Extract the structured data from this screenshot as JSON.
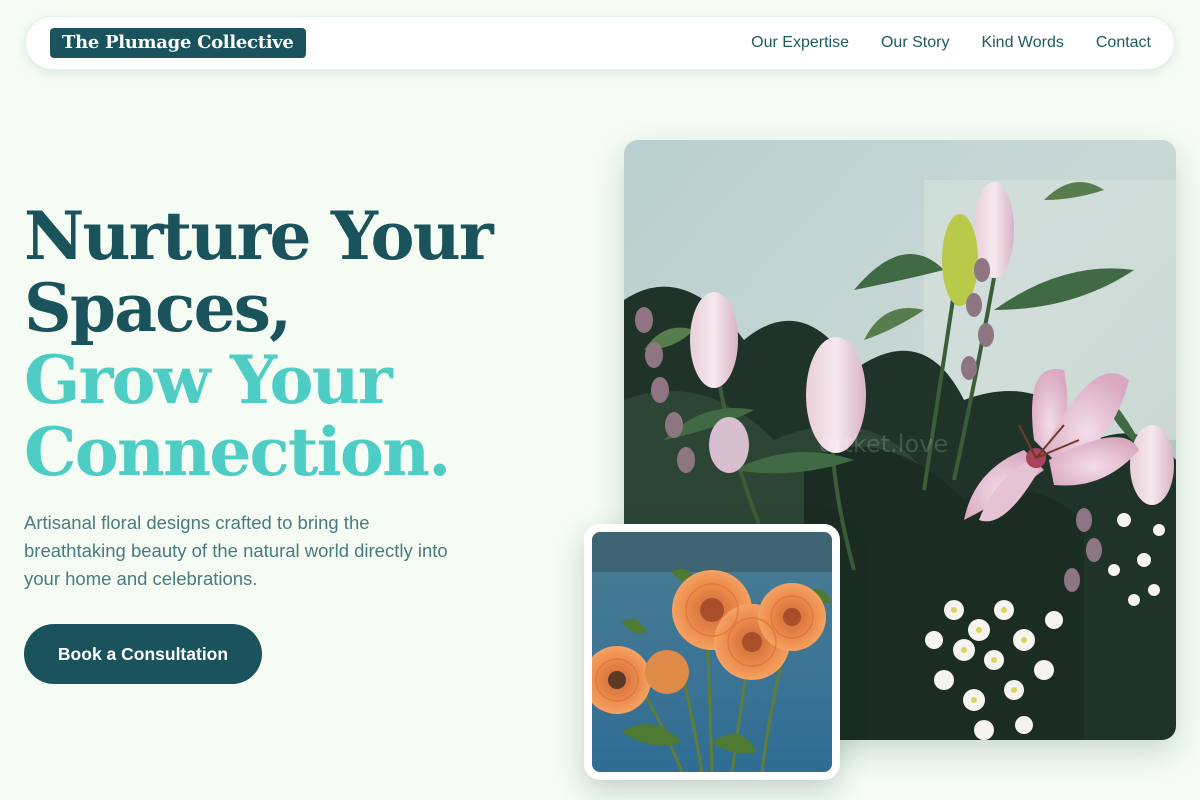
{
  "brand": {
    "name": "The Plumage Collective"
  },
  "nav": {
    "links": [
      {
        "label": "Our Expertise"
      },
      {
        "label": "Our Story"
      },
      {
        "label": "Kind Words"
      },
      {
        "label": "Contact"
      }
    ]
  },
  "hero": {
    "title_lines": [
      "Nurture Your",
      "Spaces,",
      "Grow Your",
      "Connection."
    ],
    "subtitle": "Artisanal floral designs crafted to bring the breathtaking beauty of the natural world directly into your home and celebrations.",
    "cta_label": "Book a Consultation"
  },
  "colors": {
    "background": "#f4fcf3",
    "primary": "#1a535c",
    "accent": "#4ecdc4",
    "body_text": "#4b7a80"
  }
}
